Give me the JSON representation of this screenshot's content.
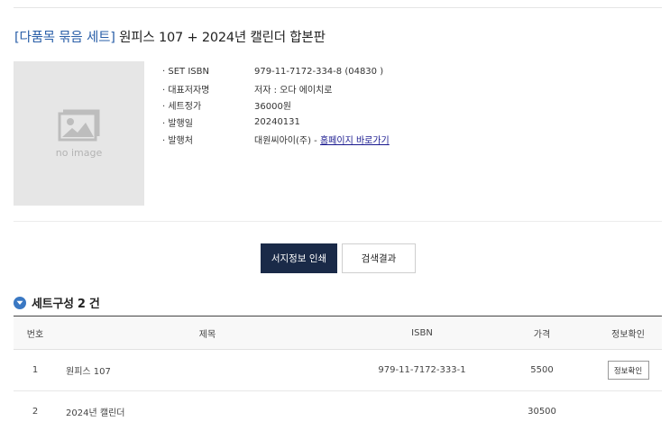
{
  "title": {
    "tag": "[다품목 묶음 세트]",
    "text": "원피스 107 + 2024년 캘린더 합본판"
  },
  "cover": {
    "placeholder": "no image",
    "icon": "image-placeholder-icon"
  },
  "info": [
    {
      "label": "SET ISBN",
      "value": "979-11-7172-334-8 (04830 )"
    },
    {
      "label": "대표저자명",
      "value": "저자 : 오다 에이치로"
    },
    {
      "label": "세트정가",
      "value": "36000원"
    },
    {
      "label": "발행일",
      "value": "20240131"
    },
    {
      "label": "발행처",
      "value": "대원씨아이(주) - ",
      "link": "홈페이지 바로가기"
    }
  ],
  "buttons": {
    "print": "서지정보 인쇄",
    "search": "검색결과"
  },
  "section": {
    "title": "세트구성 2 건",
    "icon": "chevron-down-circle-icon"
  },
  "table": {
    "headers": {
      "num": "번호",
      "title": "제목",
      "isbn": "ISBN",
      "price": "가격",
      "info": "정보확인"
    },
    "rows": [
      {
        "num": "1",
        "title": "원피스 107",
        "isbn": "979-11-7172-333-1",
        "price": "5500",
        "info": "정보확인"
      },
      {
        "num": "2",
        "title": "2024년 캘린더",
        "isbn": "",
        "price": "30500",
        "info": ""
      }
    ]
  },
  "colors": {
    "accent": "#2a5fa8",
    "button_dark": "#1a2a48",
    "section_icon": "#3a78c3",
    "link": "#1a1a8f"
  }
}
